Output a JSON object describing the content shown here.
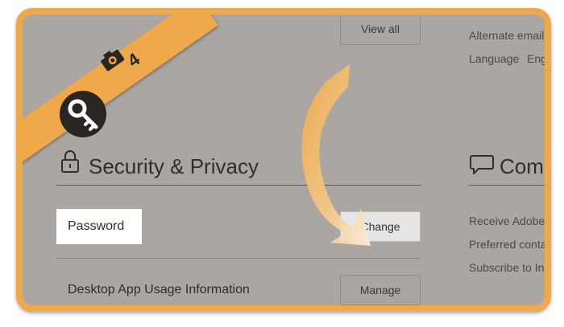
{
  "top": {
    "view_all_label": "View all"
  },
  "right_top": {
    "alternate_email_label": "Alternate email",
    "language_label": "Language",
    "language_value": "Eng"
  },
  "security": {
    "heading": "Security & Privacy",
    "password_label": "Password",
    "change_label": "Change",
    "desktop_usage_label": "Desktop App Usage Information",
    "manage_label": "Manage"
  },
  "communication": {
    "heading": "Com",
    "items": [
      "Receive Adobe",
      "Preferred conta",
      "Subscribe to In"
    ]
  },
  "badge": {
    "step": "4"
  },
  "colors": {
    "accent": "#f0a94a",
    "overlay": "#aba6a1",
    "badge_dark": "#2a2522"
  }
}
